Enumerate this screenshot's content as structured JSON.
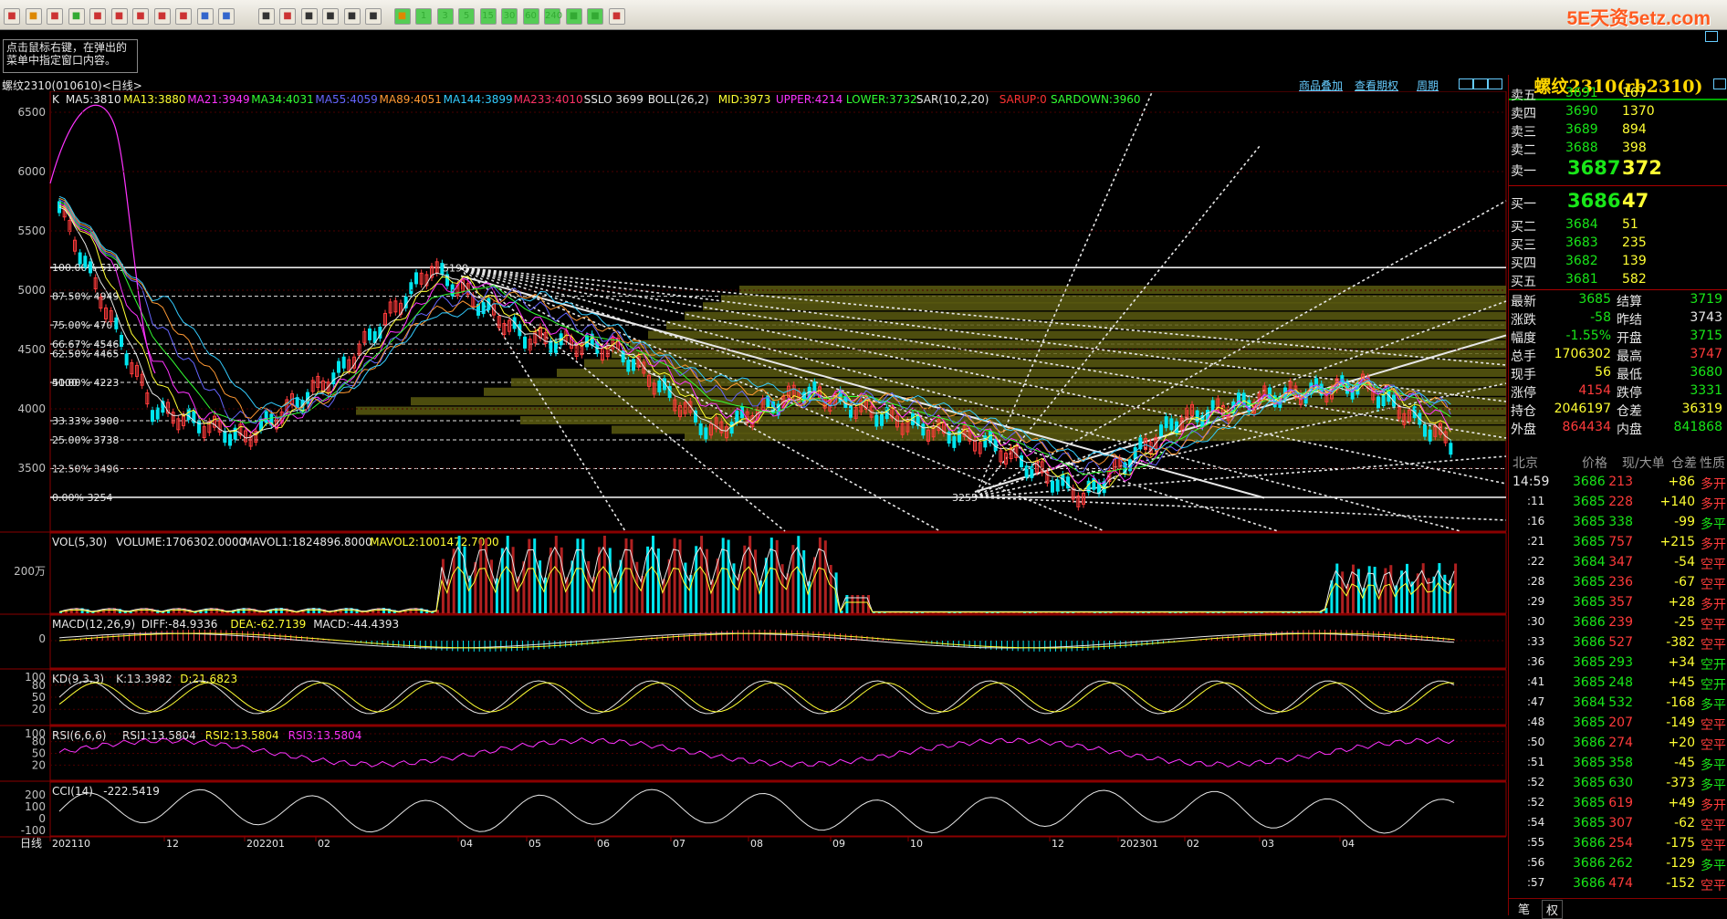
{
  "app": {
    "logo_text": "5E天资5etz.com",
    "hint": "点击鼠标右键，在弹出的菜单中指定窗口内容。"
  },
  "toolbar": {
    "buttons": [
      "home",
      "file",
      "window",
      "refresh",
      "zoom-in",
      "zoom-out",
      "chart",
      "pen",
      "settings",
      "filter",
      "network",
      "table",
      "line",
      "day",
      "week",
      "month",
      "season",
      "x",
      "1",
      "3",
      "5",
      "15",
      "30",
      "60",
      "240",
      "min",
      "y",
      "calc"
    ]
  },
  "chart_header": {
    "symbol": "螺纹2310(010610)<日线>",
    "links": {
      "overlay": "商品叠加",
      "options": "查看期权",
      "cycle": "周期"
    }
  },
  "main_legend": [
    {
      "text": "K",
      "color": "#e8e8e8"
    },
    {
      "text": "MA5:3810",
      "color": "#e8e8e8"
    },
    {
      "text": "MA13:3880",
      "color": "#ffff33"
    },
    {
      "text": "MA21:3949",
      "color": "#ff33ff"
    },
    {
      "text": "MA34:4031",
      "color": "#33ff33"
    },
    {
      "text": "MA55:4059",
      "color": "#6666ff"
    },
    {
      "text": "MA89:4051",
      "color": "#ff9933"
    },
    {
      "text": "MA144:3899",
      "color": "#33ccff"
    },
    {
      "text": "MA233:4010",
      "color": "#ff3366"
    },
    {
      "text": "SSLO 3699",
      "color": "#e8e8e8"
    },
    {
      "text": "BOLL(26,2)",
      "color": "#e8e8e8"
    },
    {
      "text": "MID:3973",
      "color": "#ffff33"
    },
    {
      "text": "UPPER:4214",
      "color": "#ff33ff"
    },
    {
      "text": "LOWER:3732",
      "color": "#33ff33"
    },
    {
      "text": "SAR(10,2,20)",
      "color": "#e8e8e8"
    },
    {
      "text": "SARUP:0",
      "color": "#ff3333"
    },
    {
      "text": "SARDOWN:3960",
      "color": "#33ff33"
    }
  ],
  "price_axis": [
    "6500",
    "6000",
    "5500",
    "5000",
    "4500",
    "4000",
    "3500"
  ],
  "fib_levels": [
    {
      "label": "100.00%  5191",
      "value": 5191
    },
    {
      "label": "87.50%  4949",
      "value": 4949
    },
    {
      "label": "75.00%  4707",
      "value": 4707
    },
    {
      "label": "66.67%  4546",
      "value": 4546
    },
    {
      "label": "62.50%  4465",
      "value": 4465
    },
    {
      "label": "50.00%  4223",
      "value": 4223
    },
    {
      "label": "33.33%  3900",
      "value": 3900
    },
    {
      "label": "25.00%  3738",
      "value": 3738
    },
    {
      "label": "12.50%  3496",
      "value": 3496
    },
    {
      "label": "0.00%  3254",
      "value": 3254
    }
  ],
  "price_marks": {
    "high": "5190",
    "low": "3255",
    "mid": "4100"
  },
  "vol_panel": {
    "legend": [
      {
        "text": "VOL(5,30)",
        "color": "#e8e8e8"
      },
      {
        "text": "VOLUME:1706302.0000",
        "color": "#e8e8e8"
      },
      {
        "text": "MAVOL1:1824896.8000",
        "color": "#e8e8e8"
      },
      {
        "text": "MAVOL2:1001472.7000",
        "color": "#ffff33"
      }
    ],
    "axis": [
      "200万"
    ]
  },
  "macd_panel": {
    "legend": [
      {
        "text": "MACD(12,26,9)",
        "color": "#e8e8e8"
      },
      {
        "text": "DIFF:-84.9336",
        "color": "#e8e8e8"
      },
      {
        "text": "DEA:-62.7139",
        "color": "#ffff33"
      },
      {
        "text": "MACD:-44.4393",
        "color": "#e8e8e8"
      }
    ],
    "axis": [
      "0"
    ]
  },
  "kd_panel": {
    "legend": [
      {
        "text": "KD(9,3,3)",
        "color": "#e8e8e8"
      },
      {
        "text": "K:13.3982",
        "color": "#e8e8e8"
      },
      {
        "text": "D:21.6823",
        "color": "#ffff33"
      }
    ],
    "axis": [
      "100",
      "80",
      "50",
      "20"
    ]
  },
  "rsi_panel": {
    "legend": [
      {
        "text": "RSI(6,6,6)",
        "color": "#e8e8e8"
      },
      {
        "text": "RSI1:13.5804",
        "color": "#e8e8e8"
      },
      {
        "text": "RSI2:13.5804",
        "color": "#ffff33"
      },
      {
        "text": "RSI3:13.5804",
        "color": "#ff33ff"
      }
    ],
    "axis": [
      "100",
      "80",
      "50",
      "20"
    ]
  },
  "cci_panel": {
    "legend": [
      {
        "text": "CCI(14)",
        "color": "#e8e8e8"
      },
      {
        "text": "-222.5419",
        "color": "#e8e8e8"
      }
    ],
    "axis": [
      "200",
      "100",
      "0",
      "-100"
    ]
  },
  "date_axis": {
    "label": "日线",
    "ticks": [
      "202110",
      "12",
      "202201",
      "02",
      "04",
      "05",
      "06",
      "07",
      "08",
      "09",
      "10",
      "12",
      "202301",
      "02",
      "03",
      "04"
    ]
  },
  "quote_panel": {
    "title": "螺纹2310(rb2310)",
    "asks": [
      {
        "label": "卖五",
        "price": "3691",
        "vol": "167"
      },
      {
        "label": "卖四",
        "price": "3690",
        "vol": "1370"
      },
      {
        "label": "卖三",
        "price": "3689",
        "vol": "894"
      },
      {
        "label": "卖二",
        "price": "3688",
        "vol": "398"
      },
      {
        "label": "卖一",
        "price": "3687",
        "vol": "372"
      }
    ],
    "bids": [
      {
        "label": "买一",
        "price": "3686",
        "vol": "47"
      },
      {
        "label": "买二",
        "price": "3684",
        "vol": "51"
      },
      {
        "label": "买三",
        "price": "3683",
        "vol": "235"
      },
      {
        "label": "买四",
        "price": "3682",
        "vol": "139"
      },
      {
        "label": "买五",
        "price": "3681",
        "vol": "582"
      }
    ],
    "stats": [
      {
        "l1": "最新",
        "v1": "3685",
        "c1": "#19e619",
        "l2": "结算",
        "v2": "3719",
        "c2": "#19e619"
      },
      {
        "l1": "涨跌",
        "v1": "-58",
        "c1": "#19e619",
        "l2": "昨结",
        "v2": "3743",
        "c2": "#e8e8e8"
      },
      {
        "l1": "幅度",
        "v1": "-1.55%",
        "c1": "#19e619",
        "l2": "开盘",
        "v2": "3715",
        "c2": "#19e619"
      },
      {
        "l1": "总手",
        "v1": "1706302",
        "c1": "#ffff33",
        "l2": "最高",
        "v2": "3747",
        "c2": "#ff3b3b"
      },
      {
        "l1": "现手",
        "v1": "56",
        "c1": "#ffff33",
        "l2": "最低",
        "v2": "3680",
        "c2": "#19e619"
      },
      {
        "l1": "涨停",
        "v1": "4154",
        "c1": "#ff3b3b",
        "l2": "跌停",
        "v2": "3331",
        "c2": "#19e619"
      },
      {
        "l1": "持仓",
        "v1": "2046197",
        "c1": "#ffff33",
        "l2": "仓差",
        "v2": "36319",
        "c2": "#ffff33"
      },
      {
        "l1": "外盘",
        "v1": "864434",
        "c1": "#ff3b3b",
        "l2": "内盘",
        "v2": "841868",
        "c2": "#19e619"
      }
    ],
    "tick_header": {
      "loc": "北京",
      "price": "价格",
      "vol": "现/大单",
      "oi": "仓差",
      "nature": "性质"
    },
    "ticks": [
      {
        "t": "14:59",
        "p": "3686",
        "v": "213",
        "d": "+86",
        "n": "多开"
      },
      {
        "t": ":11",
        "p": "3685",
        "v": "228",
        "d": "+140",
        "n": "多开"
      },
      {
        "t": ":16",
        "p": "3685",
        "v": "338",
        "d": "-99",
        "n": "多平"
      },
      {
        "t": ":21",
        "p": "3685",
        "v": "757",
        "d": "+215",
        "n": "多开"
      },
      {
        "t": ":22",
        "p": "3684",
        "v": "347",
        "d": "-54",
        "n": "空平"
      },
      {
        "t": ":28",
        "p": "3685",
        "v": "236",
        "d": "-67",
        "n": "空平"
      },
      {
        "t": ":29",
        "p": "3685",
        "v": "357",
        "d": "+28",
        "n": "多开"
      },
      {
        "t": ":30",
        "p": "3686",
        "v": "239",
        "d": "-25",
        "n": "空平"
      },
      {
        "t": ":33",
        "p": "3686",
        "v": "527",
        "d": "-382",
        "n": "空平"
      },
      {
        "t": ":36",
        "p": "3685",
        "v": "293",
        "d": "+34",
        "n": "空开"
      },
      {
        "t": ":41",
        "p": "3685",
        "v": "248",
        "d": "+45",
        "n": "空开"
      },
      {
        "t": ":47",
        "p": "3684",
        "v": "532",
        "d": "-168",
        "n": "多平"
      },
      {
        "t": ":48",
        "p": "3685",
        "v": "207",
        "d": "-149",
        "n": "空平"
      },
      {
        "t": ":50",
        "p": "3686",
        "v": "274",
        "d": "+20",
        "n": "空平"
      },
      {
        "t": ":51",
        "p": "3685",
        "v": "358",
        "d": "-45",
        "n": "多平"
      },
      {
        "t": ":52",
        "p": "3685",
        "v": "630",
        "d": "-373",
        "n": "多平"
      },
      {
        "t": ":52",
        "p": "3685",
        "v": "619",
        "d": "+49",
        "n": "多开"
      },
      {
        "t": ":54",
        "p": "3685",
        "v": "307",
        "d": "-62",
        "n": "空平"
      },
      {
        "t": ":55",
        "p": "3686",
        "v": "254",
        "d": "-175",
        "n": "空平"
      },
      {
        "t": ":56",
        "p": "3686",
        "v": "262",
        "d": "-129",
        "n": "多平"
      },
      {
        "t": ":57",
        "p": "3686",
        "v": "474",
        "d": "-152",
        "n": "空平"
      }
    ],
    "bottom_tabs": [
      "笔",
      "权"
    ]
  },
  "chart_data": {
    "type": "line",
    "title": "螺纹2310(010610)<日线>",
    "x": [
      "202110",
      "12",
      "202201",
      "02",
      "04",
      "05",
      "06",
      "07",
      "08",
      "09",
      "10",
      "12",
      "202301",
      "02",
      "03",
      "04"
    ],
    "ylim": [
      3200,
      6600
    ],
    "series": [
      {
        "name": "K",
        "values": [
          5700,
          4000,
          3750,
          4300,
          5190,
          4600,
          4500,
          3800,
          4150,
          3900,
          3700,
          3255,
          3900,
          4100,
          4200,
          3685
        ]
      }
    ]
  }
}
